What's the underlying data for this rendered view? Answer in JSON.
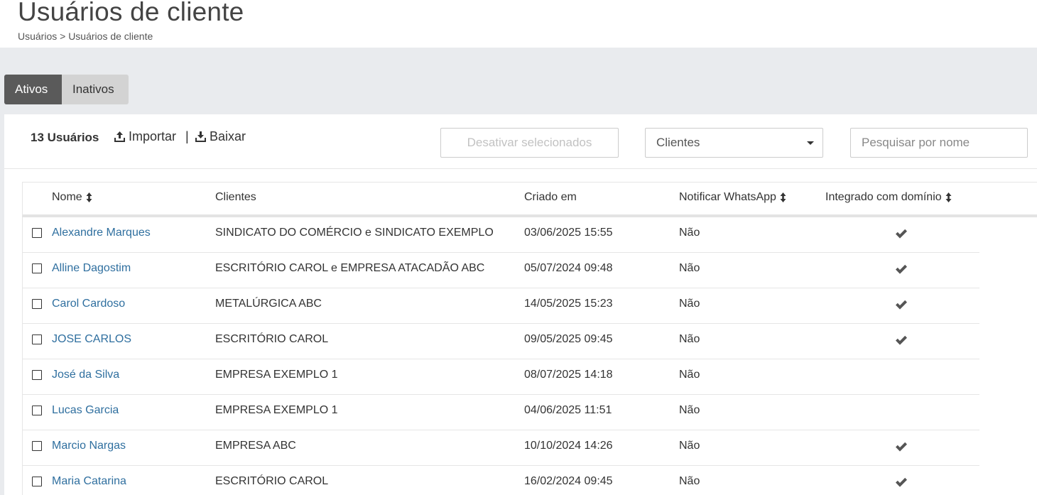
{
  "header": {
    "title": "Usuários de cliente",
    "breadcrumb": "Usuários > Usuários de cliente"
  },
  "tabs": [
    {
      "label": "Ativos",
      "active": true
    },
    {
      "label": "Inativos",
      "active": false
    }
  ],
  "toolbar": {
    "user_count": "13 Usuários",
    "import_label": "Importar",
    "separator": "|",
    "download_label": "Baixar",
    "deactivate_label": "Desativar selecionados",
    "clients_select": "Clientes",
    "search_placeholder": "Pesquisar por nome"
  },
  "table": {
    "headers": {
      "name": "Nome",
      "clients": "Clientes",
      "created": "Criado em",
      "notify": "Notificar WhatsApp",
      "integrated": "Integrado com domínio"
    },
    "rows": [
      {
        "name": "Alexandre Marques",
        "clients": "SINDICATO DO COMÉRCIO e SINDICATO EXEMPLO",
        "created": "03/06/2025 15:55",
        "notify": "Não",
        "integrated": true
      },
      {
        "name": "Alline Dagostim",
        "clients": "ESCRITÓRIO CAROL e EMPRESA ATACADÃO ABC",
        "created": "05/07/2024 09:48",
        "notify": "Não",
        "integrated": true
      },
      {
        "name": "Carol Cardoso",
        "clients": "METALÚRGICA ABC",
        "created": "14/05/2025 15:23",
        "notify": "Não",
        "integrated": true
      },
      {
        "name": "JOSE CARLOS",
        "clients": "ESCRITÓRIO CAROL",
        "created": "09/05/2025 09:45",
        "notify": "Não",
        "integrated": true
      },
      {
        "name": "José da Silva",
        "clients": "EMPRESA EXEMPLO 1",
        "created": "08/07/2025 14:18",
        "notify": "Não",
        "integrated": false
      },
      {
        "name": "Lucas Garcia",
        "clients": "EMPRESA EXEMPLO 1",
        "created": "04/06/2025 11:51",
        "notify": "Não",
        "integrated": false
      },
      {
        "name": "Marcio Nargas",
        "clients": "EMPRESA ABC",
        "created": "10/10/2024 14:26",
        "notify": "Não",
        "integrated": true
      },
      {
        "name": "Maria Catarina",
        "clients": "ESCRITÓRIO CAROL",
        "created": "16/02/2024 09:45",
        "notify": "Não",
        "integrated": true
      }
    ]
  },
  "colors": {
    "link": "#2f6f9f",
    "active_tab": "#5a5a5a",
    "inactive_tab": "#d3d3d3",
    "page_bg": "#e9ebee"
  },
  "icons": {
    "import": "upload-icon",
    "download": "download-icon",
    "sort": "sort-icon",
    "integrated": "check-icon",
    "dropdown": "chevron-down-icon"
  }
}
